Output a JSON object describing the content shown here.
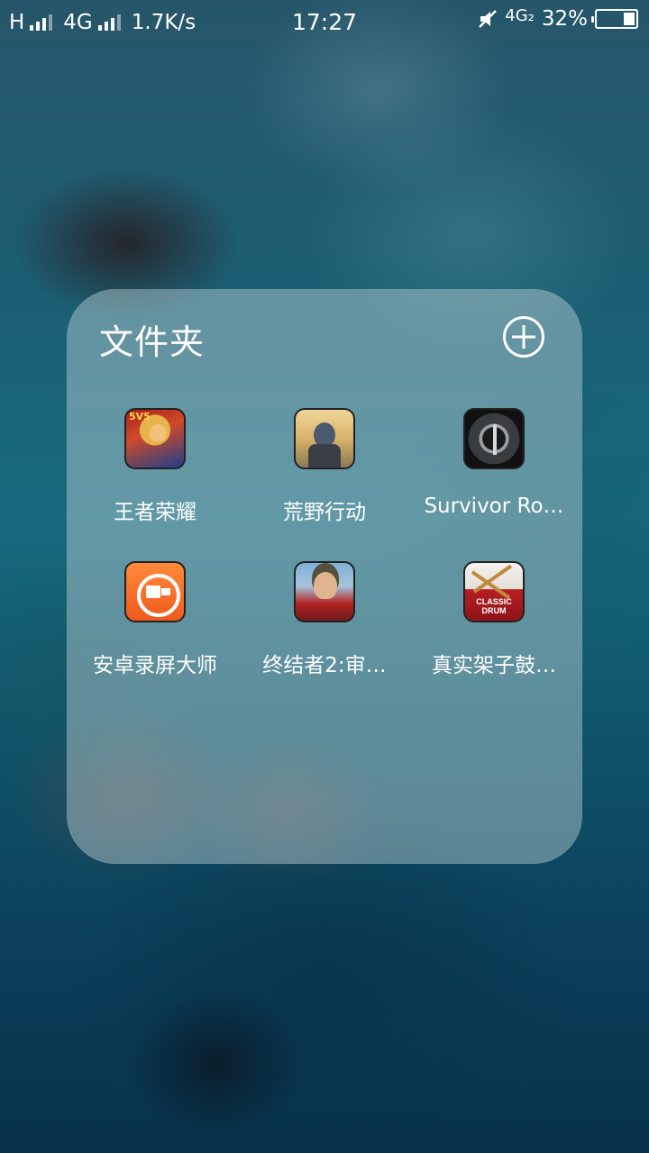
{
  "status_bar": {
    "carrier1": "H",
    "carrier2": "4G",
    "speed": "1.7K/s",
    "time": "17:27",
    "network_right": "4G₂",
    "battery": "32%",
    "battery_level": 0.32
  },
  "folder": {
    "title": "文件夹",
    "add_icon": "plus-circle-icon"
  },
  "apps": [
    {
      "label": "王者荣耀",
      "icon": "honor-of-kings-icon",
      "icon_text": "5V5"
    },
    {
      "label": "荒野行动",
      "icon": "knives-out-icon"
    },
    {
      "label": "Survivor Ro…",
      "icon": "survivor-royale-icon"
    },
    {
      "label": "安卓录屏大师",
      "icon": "screen-recorder-icon"
    },
    {
      "label": "终结者2:审…",
      "icon": "terminator-2-icon"
    },
    {
      "label": "真实架子鼓…",
      "icon": "classic-drum-icon",
      "icon_text": "CLASSIC DRUM"
    }
  ]
}
